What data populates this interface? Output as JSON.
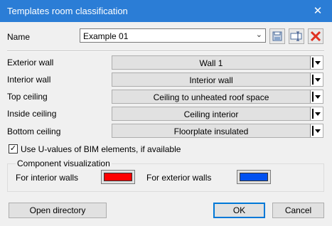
{
  "window": {
    "title": "Templates room classification",
    "close_glyph": "✕"
  },
  "name_row": {
    "label": "Name",
    "value": "Example 01",
    "tools": [
      "save-icon",
      "rename-icon",
      "delete-icon"
    ]
  },
  "rows": [
    {
      "label": "Exterior wall",
      "value": "Wall 1"
    },
    {
      "label": "Interior wall",
      "value": "Interior wall"
    },
    {
      "label": "Top ceiling",
      "value": "Ceiling to unheated roof space"
    },
    {
      "label": "Inside ceiling",
      "value": "Ceiling interior"
    },
    {
      "label": "Bottom ceiling",
      "value": "Floorplate insulated"
    }
  ],
  "checkbox": {
    "label": "Use U-values of BIM elements, if available",
    "checked": true,
    "mark": "✓"
  },
  "visualization": {
    "title": "Component visualization",
    "interior_label": "For interior walls",
    "interior_color": "#ff0000",
    "exterior_label": "For exterior walls",
    "exterior_color": "#0050f0"
  },
  "buttons": {
    "open_directory": "Open directory",
    "ok": "OK",
    "cancel": "Cancel"
  }
}
